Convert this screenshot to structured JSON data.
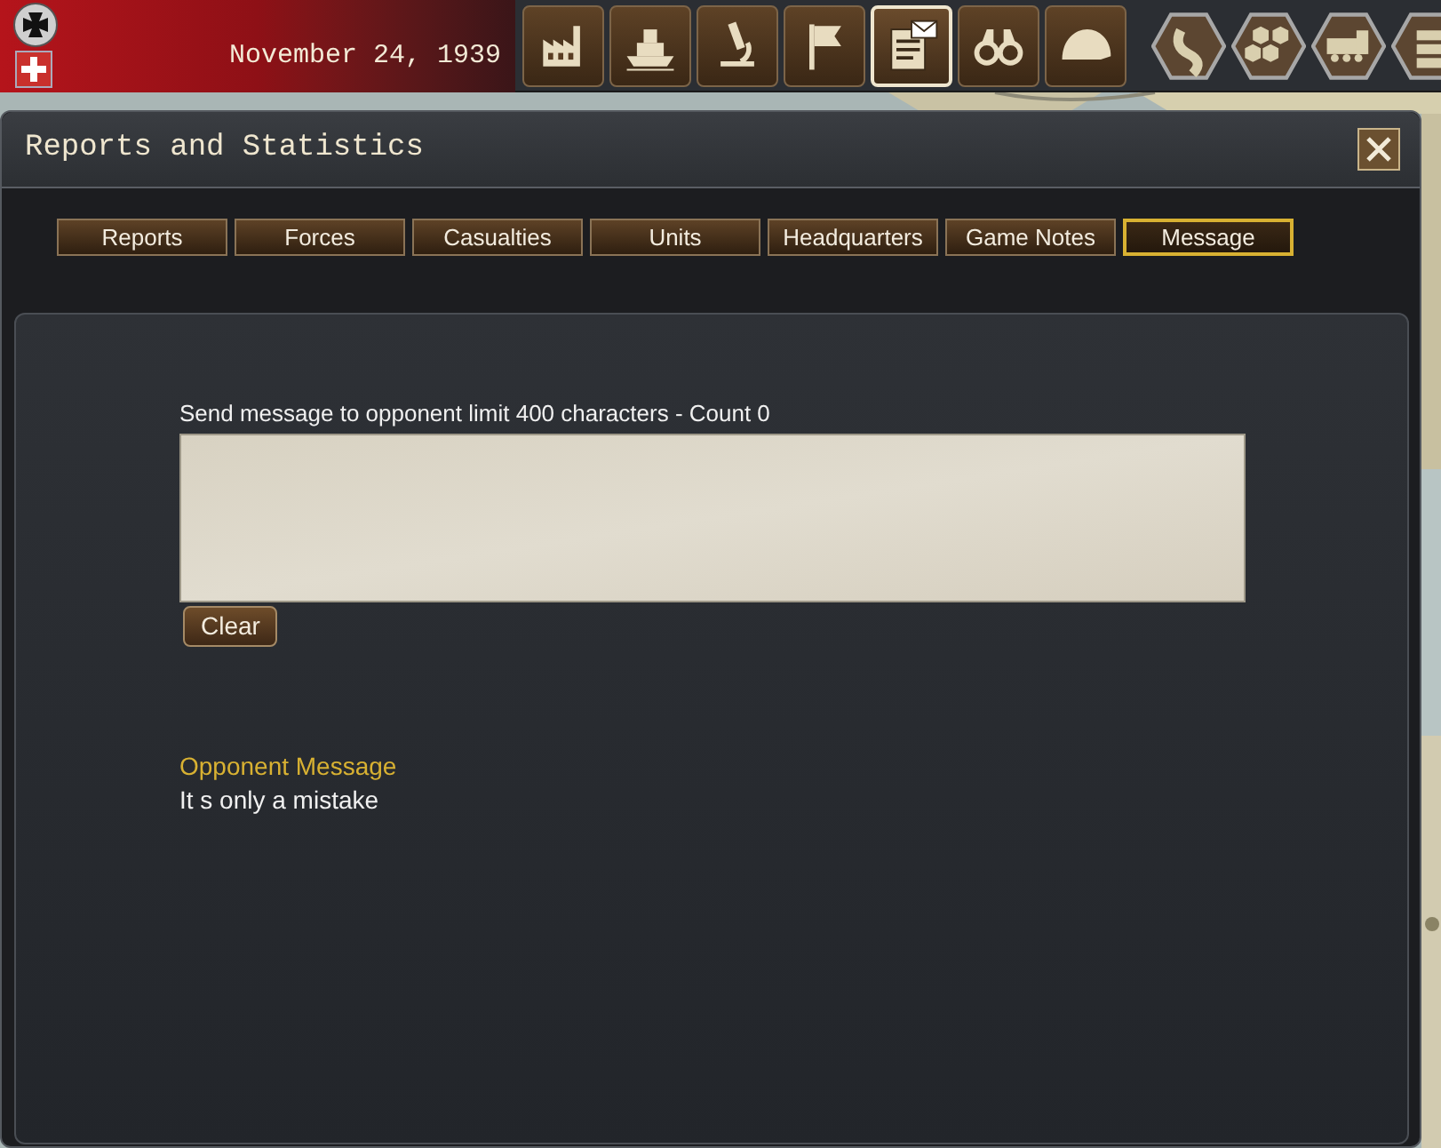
{
  "top_bar": {
    "date": "November 24, 1939",
    "toolbar": [
      {
        "kind": "factory",
        "selected": false
      },
      {
        "kind": "ship",
        "selected": false
      },
      {
        "kind": "microscope",
        "selected": false
      },
      {
        "kind": "flag",
        "selected": false
      },
      {
        "kind": "report",
        "selected": true
      },
      {
        "kind": "binoculars",
        "selected": false
      },
      {
        "kind": "helmet",
        "selected": false
      }
    ],
    "hex_buttons": [
      {
        "kind": "road"
      },
      {
        "kind": "hexes"
      },
      {
        "kind": "train"
      },
      {
        "kind": "stack"
      }
    ]
  },
  "window": {
    "title": "Reports and Statistics",
    "tabs": [
      {
        "label": "Reports",
        "selected": false
      },
      {
        "label": "Forces",
        "selected": false
      },
      {
        "label": "Casualties",
        "selected": false
      },
      {
        "label": "Units",
        "selected": false
      },
      {
        "label": "Headquarters",
        "selected": false
      },
      {
        "label": "Game Notes",
        "selected": false
      },
      {
        "label": "Message",
        "selected": true
      }
    ],
    "message": {
      "label": "Send message to opponent limit 400 characters - Count 0",
      "clear_button": "Clear"
    },
    "opponent": {
      "heading": "Opponent Message",
      "text": "It s only a mistake"
    }
  }
}
